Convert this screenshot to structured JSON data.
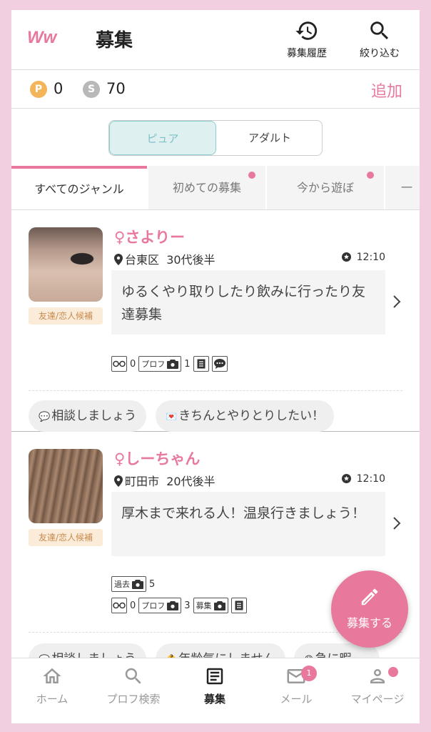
{
  "header": {
    "logo_text": "Ww",
    "title": "募集",
    "history_label": "募集履歴",
    "filter_label": "絞り込む"
  },
  "points": {
    "p_icon": "P",
    "p_value": "0",
    "s_icon": "S",
    "s_value": "70",
    "add_label": "追加"
  },
  "segment": {
    "options": [
      "ピュア",
      "アダルト"
    ],
    "selected": "ピュア"
  },
  "genre_tabs": [
    "すべてのジャンル",
    "初めての募集",
    "今から遊ぼ",
    "一"
  ],
  "posts": [
    {
      "nickname": "♀さよりー",
      "area": "台東区",
      "age": "30代後半",
      "time": "12:10",
      "relationship": "友達/恋人候補",
      "message": "ゆるくやり取りしたり飲みに行ったり友達募集",
      "stats": {
        "glasses": "0",
        "prof_label": "プロフ",
        "prof_photos": "1"
      },
      "chips": [
        "相談しましょう",
        "きちんとやりとりしたい！"
      ]
    },
    {
      "nickname": "♀しーちゃん",
      "area": "町田市",
      "age": "20代後半",
      "time": "12:10",
      "relationship": "友達/恋人候補",
      "message": "厚木まで来れる人！温泉行きましょう！",
      "stats": {
        "past_label": "過去",
        "past_photos": "5",
        "glasses": "0",
        "prof_label": "プロフ",
        "prof_photos": "3",
        "recruit_label": "募集"
      },
      "chips": [
        "相談しましょう",
        "年齢気にしません",
        "急に暇。。"
      ]
    }
  ],
  "fab_label": "募集する",
  "bottom_nav": {
    "items": [
      "ホーム",
      "プロフ検索",
      "募集",
      "メール",
      "マイページ"
    ],
    "active": "募集",
    "mail_badge": "1"
  },
  "colors": {
    "accent": "#e8799c",
    "background": "#f2cfe0",
    "pure_tab": "#dff0f1"
  }
}
